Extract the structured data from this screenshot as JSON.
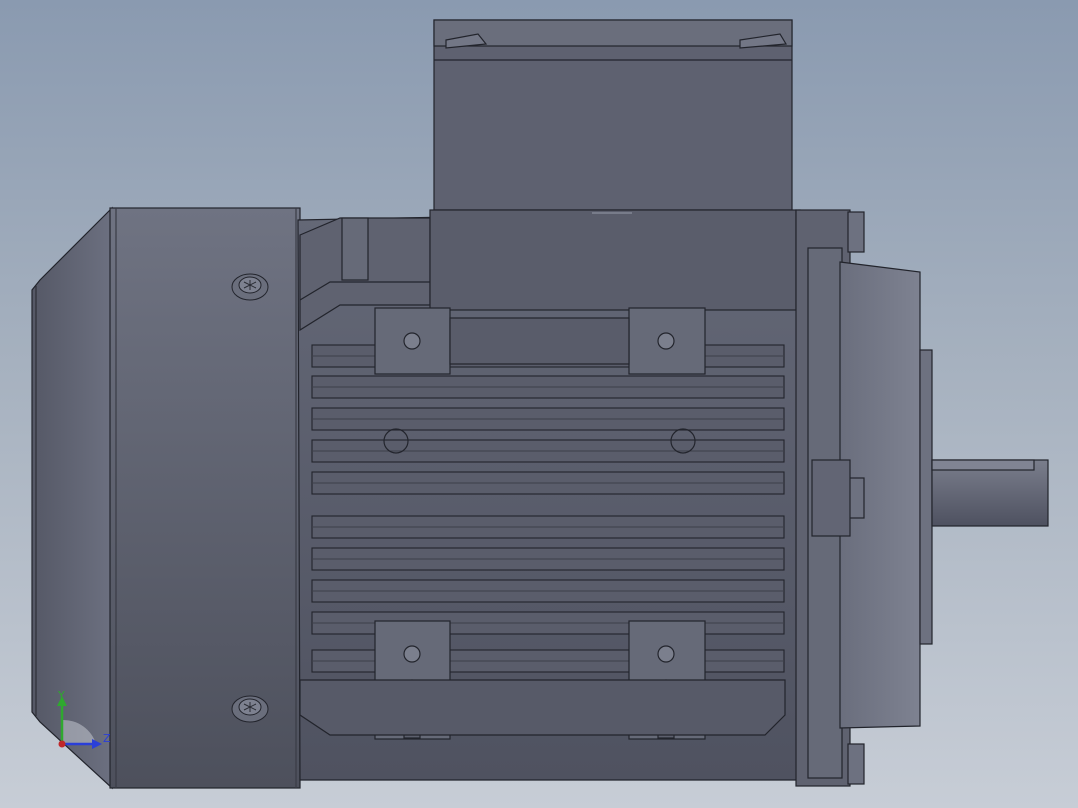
{
  "viewport": {
    "background_top": "#8a9ab0",
    "background_bottom": "#c7cdd6"
  },
  "model": {
    "body_color": "#5b5e6a",
    "edge_color": "#22242c",
    "highlight_color": "#7b7f8c"
  },
  "triad": {
    "y_label": "Y",
    "z_label": "Z",
    "y_color": "#2fa82f",
    "z_color": "#2a3fd8",
    "x_color": "#c0282a"
  }
}
